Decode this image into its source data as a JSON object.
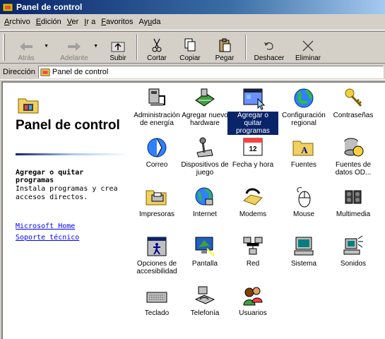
{
  "window": {
    "title": "Panel de control"
  },
  "menu": [
    "Archivo",
    "Edición",
    "Ver",
    "Ir a",
    "Favoritos",
    "Ayuda"
  ],
  "toolbar": {
    "back": "Atrás",
    "forward": "Adelante",
    "up": "Subir",
    "cut": "Cortar",
    "copy": "Copiar",
    "paste": "Pegar",
    "undo": "Deshacer",
    "delete": "Eliminar"
  },
  "address": {
    "label": "Dirección",
    "value": "Panel de control"
  },
  "left_pane": {
    "title": "Panel de control",
    "selected_title": "Agregar o quitar programas",
    "selected_desc": "Instala programas y crea accesos directos.",
    "links": [
      "Microsoft Home",
      "Soporte técnico"
    ]
  },
  "items": [
    {
      "label": "Administración de energía",
      "icon": "power-management-icon"
    },
    {
      "label": "Agregar nuevo hardware",
      "icon": "add-hardware-icon"
    },
    {
      "label": "Agregar o quitar programas",
      "icon": "add-remove-programs-icon",
      "selected": true
    },
    {
      "label": "Configuración regional",
      "icon": "globe-icon"
    },
    {
      "label": "Contraseñas",
      "icon": "keys-icon"
    },
    {
      "label": "Correo",
      "icon": "mail-icon"
    },
    {
      "label": "Dispositivos de juego",
      "icon": "joystick-icon"
    },
    {
      "label": "Fecha y hora",
      "icon": "calendar-clock-icon"
    },
    {
      "label": "Fuentes",
      "icon": "fonts-folder-icon"
    },
    {
      "label": "Fuentes de datos OD...",
      "icon": "odbc-icon"
    },
    {
      "label": "Impresoras",
      "icon": "printer-folder-icon"
    },
    {
      "label": "Internet",
      "icon": "internet-icon"
    },
    {
      "label": "Modems",
      "icon": "modem-icon"
    },
    {
      "label": "Mouse",
      "icon": "mouse-icon"
    },
    {
      "label": "Multimedia",
      "icon": "multimedia-icon"
    },
    {
      "label": "Opciones de accesibilidad",
      "icon": "accessibility-icon"
    },
    {
      "label": "Pantalla",
      "icon": "display-icon"
    },
    {
      "label": "Red",
      "icon": "network-icon"
    },
    {
      "label": "Sistema",
      "icon": "system-computer-icon"
    },
    {
      "label": "Sonidos",
      "icon": "sounds-icon"
    },
    {
      "label": "Teclado",
      "icon": "keyboard-icon"
    },
    {
      "label": "Telefonía",
      "icon": "telephony-icon"
    },
    {
      "label": "Usuarios",
      "icon": "users-icon"
    }
  ]
}
